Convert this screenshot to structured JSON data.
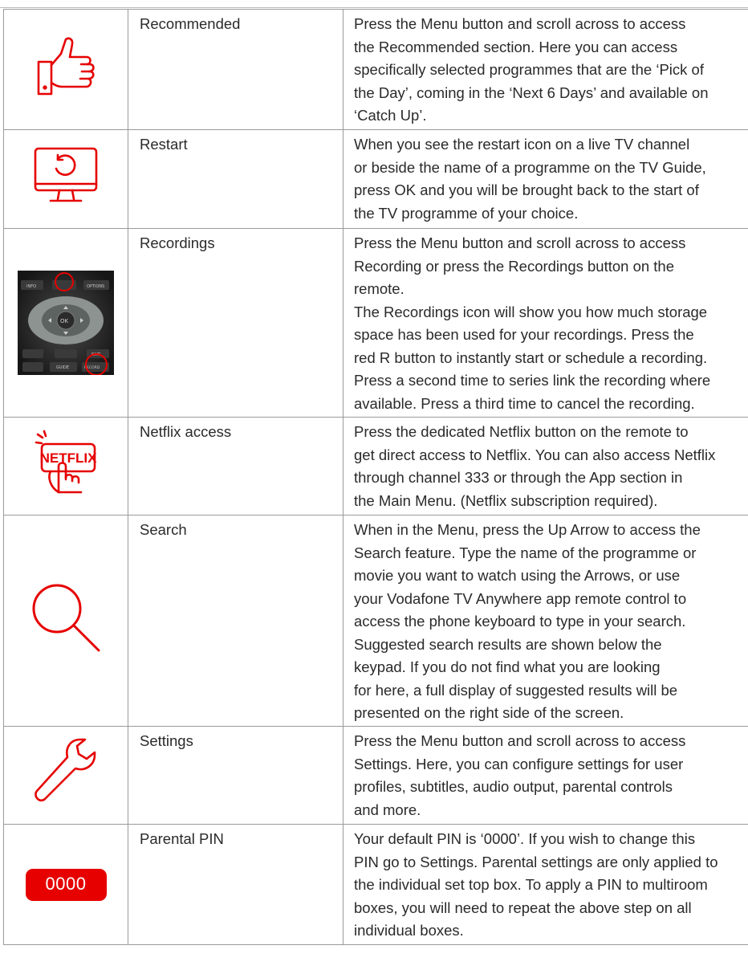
{
  "accent_color": "#e60000",
  "rows": [
    {
      "name": "Recommended",
      "icon": "thumbs-up-icon",
      "lines": [
        "Press the Menu button and scroll across to access",
        "the Recommended section. Here you can access",
        "specifically selected programmes that are the ‘Pick of",
        "the Day’, coming in the ‘Next 6 Days’ and available on",
        "‘Catch Up’."
      ]
    },
    {
      "name": "Restart",
      "icon": "restart-tv-icon",
      "lines": [
        "When you see the restart icon on a live TV channel",
        "or beside the name of a programme on the TV Guide,",
        "press OK and you will be brought back to the start of",
        "the TV programme of your choice."
      ]
    },
    {
      "name": "Recordings",
      "icon": "remote-control-photo",
      "remote_labels": {
        "info": "INFO",
        "options": "OPTIONS",
        "ok": "OK",
        "guide": "GUIDE",
        "exit": "EXIT",
        "record": "RECORD"
      },
      "lines": [
        "Press the Menu button and scroll across to access",
        "Recording or press the Recordings button on the",
        "remote.",
        "The Recordings icon will show you how much storage",
        "space has been used for your recordings. Press the",
        "red R button to instantly start or schedule a recording.",
        "Press a second time to series link the recording where",
        "available. Press a third time to cancel the recording."
      ]
    },
    {
      "name": "Netflix access",
      "icon": "netflix-button-icon",
      "icon_text": "NETFLIX",
      "lines": [
        "Press the dedicated Netflix button on the remote to",
        "get direct access to Netflix. You can also access Netflix",
        "through channel 333 or through the App section in",
        "the Main Menu. (Netflix subscription required)."
      ]
    },
    {
      "name": "Search",
      "icon": "search-icon",
      "lines": [
        "When in the Menu, press the Up Arrow to access the",
        "Search feature. Type the name of the programme or",
        "movie you want to watch using the Arrows, or use",
        "your Vodafone TV Anywhere app remote control to",
        "access the phone keyboard to type in your search.",
        "Suggested search results are shown below the",
        "keypad. If you do not find what you are looking",
        "for here, a full display of suggested results will be",
        "presented on the right side of the screen."
      ]
    },
    {
      "name": "Settings",
      "icon": "wrench-icon",
      "lines": [
        "Press the Menu button and scroll across to access",
        "Settings. Here, you can configure settings for user",
        "profiles, subtitles, audio output, parental controls",
        "and more."
      ]
    },
    {
      "name": "Parental PIN",
      "icon": "pin-badge-icon",
      "icon_text": "0000",
      "lines": [
        "Your default PIN is ‘0000’. If you wish to change this",
        "PIN go to Settings. Parental settings are only applied to",
        "the individual set top box. To apply a PIN to multiroom",
        "boxes, you will need to repeat the above step on all",
        "individual boxes."
      ]
    }
  ]
}
